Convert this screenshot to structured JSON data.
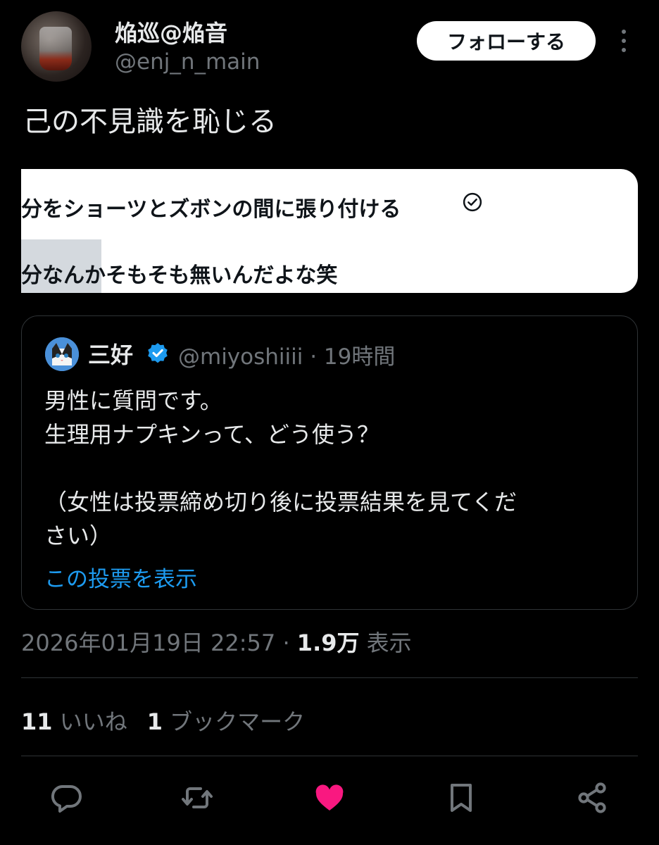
{
  "author": {
    "display_name": "焔巡@焔音",
    "handle": "@enj_n_main"
  },
  "follow_label": "フォローする",
  "tweet_text": "己の不見識を恥じる",
  "image": {
    "line1": "分をショーツとズボンの間に張り付ける",
    "line2": "分なんかそもそも無いんだよな笑"
  },
  "quote": {
    "name": "三好",
    "handle_time": "@miyoshiiii · 19時間",
    "body": "男性に質問です。\n生理用ナプキンって、どう使う？\n\n（女性は投票締め切り後に投票結果を見てくだ\nさい）",
    "link": "この投票を表示"
  },
  "meta": {
    "datetime": "2026年01月19日 22:57 · ",
    "views_count": "1.9万",
    "views_label": " 表示"
  },
  "stats": {
    "likes_count": "11",
    "likes_label": " いいね",
    "bookmarks_count": "1",
    "bookmarks_label": " ブックマーク"
  },
  "colors": {
    "background": "#000000",
    "accent": "#1d9bf0",
    "like": "#f91880",
    "muted": "#71767b"
  },
  "icons": [
    "reply-icon",
    "retweet-icon",
    "like-icon",
    "bookmark-icon",
    "share-icon",
    "verified-icon",
    "more-icon"
  ]
}
